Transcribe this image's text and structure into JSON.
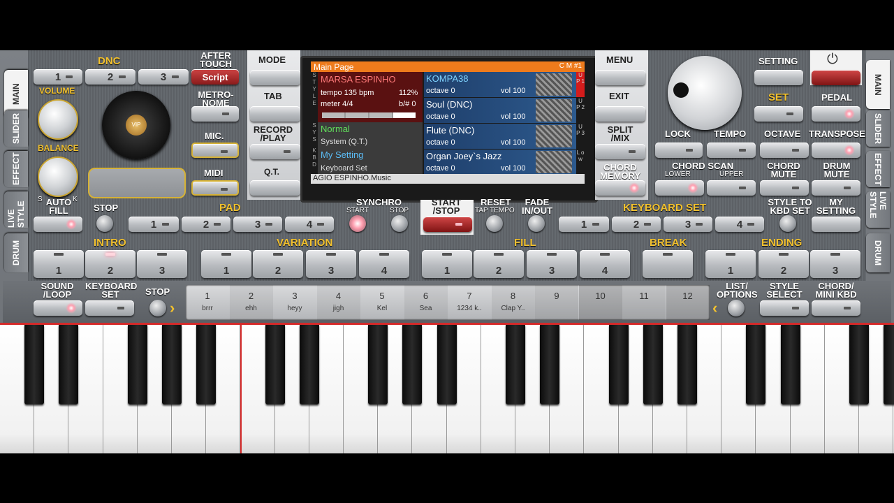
{
  "side_tabs_left": [
    "MAIN",
    "SLIDER",
    "EFFECT",
    "LIVE STYLE",
    "DRUM"
  ],
  "side_tabs_right": [
    "MAIN",
    "SLIDER",
    "EFFECT",
    "LIVE STYLE",
    "DRUM"
  ],
  "dnc": {
    "label": "DNC",
    "buttons": [
      "1",
      "2",
      "3"
    ],
    "script": "Script"
  },
  "after_touch": "AFTER TOUCH",
  "metronome": "METRO- NOME",
  "mic": "MIC.",
  "midi": "MIDI",
  "volume": "VOLUME",
  "balance": "BALANCE",
  "balance_s": "S",
  "balance_k": "K",
  "vip": "VIP",
  "mode": "MODE",
  "tab": "TAB",
  "record_play": "RECORD /PLAY",
  "qt": "Q.T.",
  "menu": "MENU",
  "exit": "EXIT",
  "split_mix": "SPLIT /MIX",
  "chord_memory": "CHORD MEMORY",
  "screen": {
    "title": "Main Page",
    "cm": "C M #1",
    "style_name": "MARSA ESPINHO",
    "tempo": "tempo 135 bpm",
    "percent": "112%",
    "meter": "meter 4/4",
    "bsharp": "b/# 0",
    "sys_name": "Normal",
    "sys_sub": "System (Q.T.)",
    "kbd_name": "My Setting",
    "kbd_sub": "Keyboard Set",
    "footer": "AGIO ESPINHO.Music",
    "side_style": "S T Y L E",
    "side_sys": "S Y S",
    "side_kbd": "K B D",
    "parts": [
      {
        "name": "KOMPA38",
        "octave": "octave  0",
        "vol": "vol 100",
        "tag": "U P 1"
      },
      {
        "name": "Soul (DNC)",
        "octave": "octave  0",
        "vol": "vol 100",
        "tag": "U P 2"
      },
      {
        "name": "Flute (DNC)",
        "octave": "octave  0",
        "vol": "vol 100",
        "tag": "U P 3"
      },
      {
        "name": "Organ Joey`s Jazz",
        "octave": "octave  0",
        "vol": "vol 100",
        "tag": "L o w"
      }
    ]
  },
  "setting": "SETTING",
  "set": "SET",
  "pedal": "PEDAL",
  "lock": "LOCK",
  "tempo": "TEMPO",
  "octave": "OCTAVE",
  "transpose": "TRANSPOSE",
  "chord_scan": "CHORD SCAN",
  "lower": "LOWER",
  "upper": "UPPER",
  "chord_mute": "CHORD MUTE",
  "drum_mute": "DRUM MUTE",
  "auto_fill": "AUTO FILL",
  "stop": "STOP",
  "pad": "PAD",
  "pad_buttons": [
    "1",
    "2",
    "3",
    "4"
  ],
  "synchro": "SYNCHRO",
  "synchro_start": "START",
  "synchro_stop": "STOP",
  "start_stop": "START /STOP",
  "reset": "RESET",
  "tap_tempo": "TAP TEMPO",
  "fade": "FADE IN/OUT",
  "keyboard_set": "KEYBOARD SET",
  "kbd_buttons": [
    "1",
    "2",
    "3",
    "4"
  ],
  "style_to_kbd": "STYLE TO KBD SET",
  "my_setting": "MY SETTING",
  "intro": "INTRO",
  "intro_buttons": [
    "1",
    "2",
    "3"
  ],
  "variation": "VARIATION",
  "variation_buttons": [
    "1",
    "2",
    "3",
    "4"
  ],
  "fill": "FILL",
  "fill_buttons": [
    "1",
    "2",
    "3",
    "4"
  ],
  "break": "BREAK",
  "ending": "ENDING",
  "ending_buttons": [
    "1",
    "2",
    "3"
  ],
  "sound_loop": "SOUND /LOOP",
  "keyboard_set2": "KEYBOARD SET",
  "stop2": "STOP",
  "list_options": "LIST/ OPTIONS",
  "style_select": "STYLE SELECT",
  "chord_mini_kbd": "CHORD/ MINI KBD",
  "slots": [
    {
      "n": "1",
      "t": "brrr"
    },
    {
      "n": "2",
      "t": "ehh"
    },
    {
      "n": "3",
      "t": "heyy"
    },
    {
      "n": "4",
      "t": "jigh"
    },
    {
      "n": "5",
      "t": "Kel"
    },
    {
      "n": "6",
      "t": "Sea"
    },
    {
      "n": "7",
      "t": "1234 k.."
    },
    {
      "n": "8",
      "t": "Clap Y.."
    },
    {
      "n": "9",
      "t": ""
    },
    {
      "n": "10",
      "t": ""
    },
    {
      "n": "11",
      "t": ""
    },
    {
      "n": "12",
      "t": ""
    }
  ],
  "colors": {
    "accent": "#f2c12e",
    "screen_header": "#ee7b1c",
    "red_led": "#d42a2a"
  }
}
